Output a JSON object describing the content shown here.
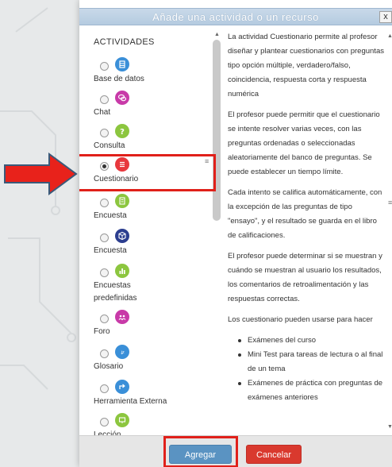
{
  "dialog": {
    "title": "Añade una actividad o un recurso",
    "close_label": "x"
  },
  "activities": {
    "heading": "ACTIVIDADES",
    "items": [
      {
        "label": "Base de datos",
        "icon": "database-icon",
        "color": "#3a8fd8",
        "selected": false
      },
      {
        "label": "Chat",
        "icon": "chat-icon",
        "color": "#c83aa8",
        "selected": false
      },
      {
        "label": "Consulta",
        "icon": "question-icon",
        "color": "#8cc63f",
        "selected": false
      },
      {
        "label": "Cuestionario",
        "icon": "quiz-icon",
        "color": "#e8383d",
        "selected": true
      },
      {
        "label": "Encuesta",
        "icon": "survey-icon",
        "color": "#8cc63f",
        "selected": false
      },
      {
        "label": "Encuesta",
        "icon": "cube-icon",
        "color": "#2c3e8f",
        "selected": false
      },
      {
        "label": "Encuestas predefinidas",
        "icon": "bar-chart-icon",
        "color": "#8cc63f",
        "selected": false
      },
      {
        "label": "Foro",
        "icon": "forum-icon",
        "color": "#c83aa8",
        "selected": false
      },
      {
        "label": "Glosario",
        "icon": "glossary-icon",
        "color": "#3a8fd8",
        "selected": false
      },
      {
        "label": "Herramienta Externa",
        "icon": "external-tool-icon",
        "color": "#3a8fd8",
        "selected": false
      },
      {
        "label": "Lección",
        "icon": "lesson-icon",
        "color": "#8cc63f",
        "selected": false
      }
    ]
  },
  "help": {
    "paragraphs": [
      "La actividad Cuestionario permite al profesor diseñar y plantear cuestionarios con preguntas tipo opción múltiple, verdadero/falso, coincidencia, respuesta corta y respuesta numérica",
      "El profesor puede permitir que el cuestionario se intente resolver varias veces, con las preguntas ordenadas o seleccionadas aleatoriamente del banco de preguntas. Se puede establecer un tiempo límite.",
      "Cada intento se califica automáticamente, con la excepción de las preguntas de tipo \"ensayo\", y el resultado se guarda en el libro de calificaciones.",
      "El profesor puede determinar si se muestran y cuándo se muestran al usuario los resultados, los comentarios de retroalimentación y las respuestas correctas.",
      "Los cuestionario pueden usarse para hacer"
    ],
    "bullets": [
      "Exámenes del curso",
      "Mini Test para tareas de lectura o al final de un tema",
      "Exámenes de práctica con preguntas de exámenes anteriores"
    ]
  },
  "footer": {
    "add_label": "Agregar",
    "cancel_label": "Cancelar"
  },
  "colors": {
    "highlight": "#e0201a",
    "add_button": "#5a93c2",
    "cancel_button": "#d9392e"
  }
}
